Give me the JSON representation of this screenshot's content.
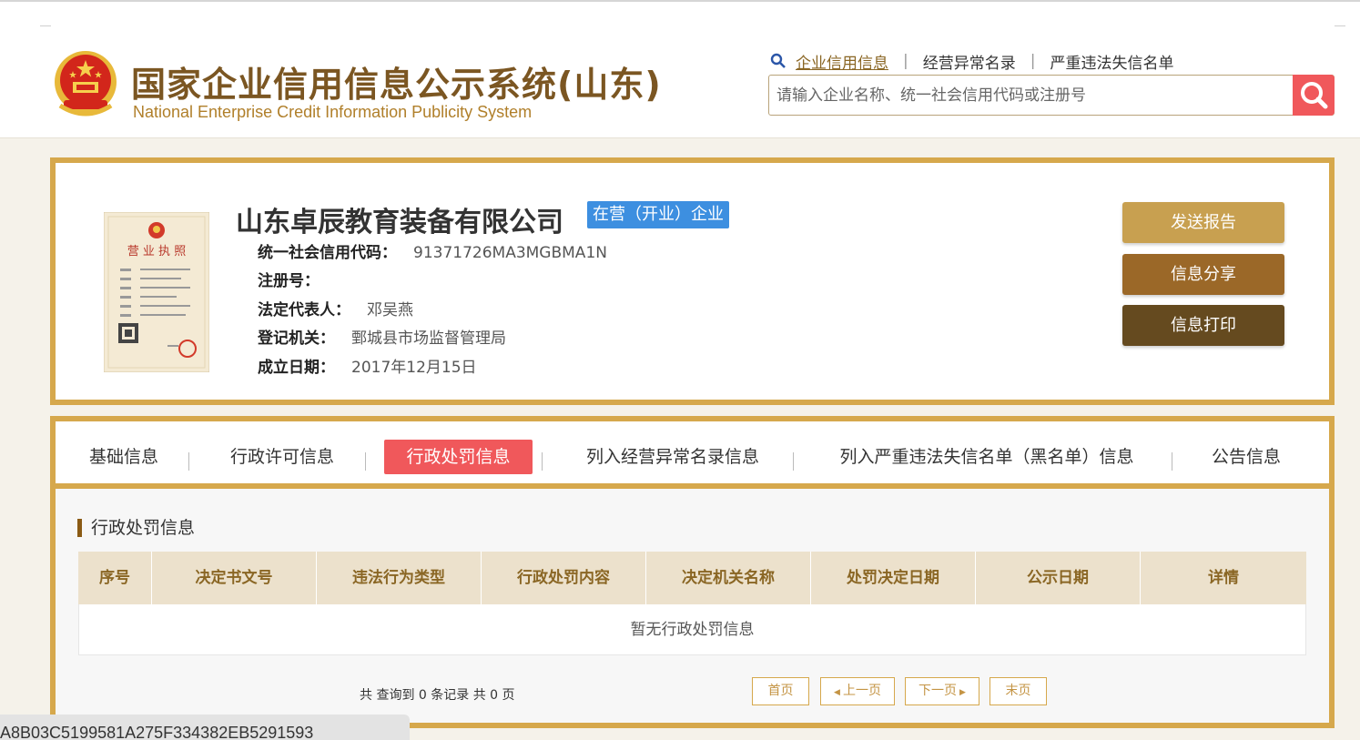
{
  "header": {
    "logo_cn": "国家企业信用信息公示系统(山东)",
    "logo_en": "National Enterprise Credit Information Publicity System",
    "nav": [
      "企业信用信息",
      "经营异常名录",
      "严重违法失信名单"
    ],
    "search_placeholder": "请输入企业名称、统一社会信用代码或注册号"
  },
  "company": {
    "name": "山东卓辰教育装备有限公司",
    "status": "在营（开业）企业",
    "credit_code_label": "统一社会信用代码：",
    "credit_code": "91371726MA3MGBMA1N",
    "reg_no_label": "注册号：",
    "legal_rep_label": "法定代表人：",
    "legal_rep": "邓吴燕",
    "authority_label": "登记机关：",
    "authority": "鄄城县市场监督管理局",
    "est_date_label": "成立日期：",
    "est_date": "2017年12月15日",
    "license_title": "营 业 执 照"
  },
  "actions": {
    "send_report": "发送报告",
    "share": "信息分享",
    "print": "信息打印"
  },
  "tabs": [
    "基础信息",
    "行政许可信息",
    "行政处罚信息",
    "列入经营异常名录信息",
    "列入严重违法失信名单（黑名单）信息",
    "公告信息"
  ],
  "section": {
    "title": "行政处罚信息",
    "columns": [
      "序号",
      "决定书文号",
      "违法行为类型",
      "行政处罚内容",
      "决定机关名称",
      "处罚决定日期",
      "公示日期",
      "详情"
    ],
    "empty_text": "暂无行政处罚信息"
  },
  "pager": {
    "info": "共 查询到 0 条记录 共 0 页",
    "first": "首页",
    "prev": "上一页",
    "next": "下一页",
    "last": "末页"
  },
  "statusbar": {
    "text": "A8B03C5199581A275F334382EB5291593"
  },
  "colors": {
    "gold_border": "#d6a84c",
    "badge_blue": "#3d8fe0",
    "active_red": "#f0585b",
    "btn_send": "#c8a050",
    "btn_share": "#9b6828",
    "btn_print": "#654a1f"
  }
}
